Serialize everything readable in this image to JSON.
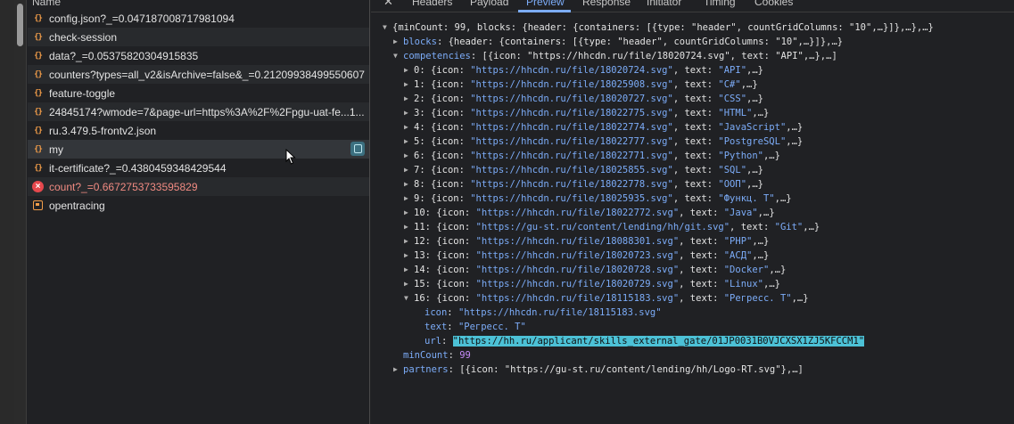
{
  "list": {
    "header": "Name",
    "rows": [
      {
        "name": "config.json?_=0.047187008717981094",
        "type": "json"
      },
      {
        "name": "check-session",
        "type": "json"
      },
      {
        "name": "data?_=0.05375820304915835",
        "type": "json"
      },
      {
        "name": "counters?types=all_v2&isArchive=false&_=0.21209938499550607",
        "type": "json"
      },
      {
        "name": "feature-toggle",
        "type": "json"
      },
      {
        "name": "24845174?wmode=7&page-url=https%3A%2F%2Fpgu-uat-fe...1...",
        "type": "json"
      },
      {
        "name": "ru.3.479.5-frontv2.json",
        "type": "json"
      },
      {
        "name": "my",
        "type": "json"
      },
      {
        "name": "it-certificate?_=0.4380459348429544",
        "type": "json"
      },
      {
        "name": "count?_=0.6672753733595829",
        "type": "error"
      },
      {
        "name": "opentracing",
        "type": "doc"
      }
    ]
  },
  "tabs": [
    "Headers",
    "Payload",
    "Preview",
    "Response",
    "Initiator",
    "Timing",
    "Cookies"
  ],
  "active_tab": "Preview",
  "close_icon": "✕",
  "tree": {
    "root": "{minCount: 99, blocks: {header: {containers: [{type: \"header\", countGridColumns: \"10\",…}]},…},…}",
    "blocks": {
      "key": "blocks",
      "value": "{header: {containers: [{type: \"header\", countGridColumns: \"10\",…}]},…}"
    },
    "competencies": {
      "key": "competencies",
      "value": "[{icon: \"https://hhcdn.ru/file/18020724.svg\", text: \"API\",…},…]"
    },
    "items": [
      {
        "idx": "0",
        "icon": "\"https://hhcdn.ru/file/18020724.svg\"",
        "text": "\"API\""
      },
      {
        "idx": "1",
        "icon": "\"https://hhcdn.ru/file/18025908.svg\"",
        "text": "\"C#\""
      },
      {
        "idx": "2",
        "icon": "\"https://hhcdn.ru/file/18020727.svg\"",
        "text": "\"CSS\""
      },
      {
        "idx": "3",
        "icon": "\"https://hhcdn.ru/file/18022775.svg\"",
        "text": "\"HTML\""
      },
      {
        "idx": "4",
        "icon": "\"https://hhcdn.ru/file/18022774.svg\"",
        "text": "\"JavaScript\""
      },
      {
        "idx": "5",
        "icon": "\"https://hhcdn.ru/file/18022777.svg\"",
        "text": "\"PostgreSQL\""
      },
      {
        "idx": "6",
        "icon": "\"https://hhcdn.ru/file/18022771.svg\"",
        "text": "\"Python\""
      },
      {
        "idx": "7",
        "icon": "\"https://hhcdn.ru/file/18025855.svg\"",
        "text": "\"SQL\""
      },
      {
        "idx": "8",
        "icon": "\"https://hhcdn.ru/file/18022778.svg\"",
        "text": "\"ООП\""
      },
      {
        "idx": "9",
        "icon": "\"https://hhcdn.ru/file/18025935.svg\"",
        "text": "\"Функц. Т\""
      },
      {
        "idx": "10",
        "icon": "\"https://hhcdn.ru/file/18022772.svg\"",
        "text": "\"Java\""
      },
      {
        "idx": "11",
        "icon": "\"https://gu-st.ru/content/lending/hh/git.svg\"",
        "text": "\"Git\""
      },
      {
        "idx": "12",
        "icon": "\"https://hhcdn.ru/file/18088301.svg\"",
        "text": "\"PHP\""
      },
      {
        "idx": "13",
        "icon": "\"https://hhcdn.ru/file/18020723.svg\"",
        "text": "\"АСД\""
      },
      {
        "idx": "14",
        "icon": "\"https://hhcdn.ru/file/18020728.svg\"",
        "text": "\"Docker\""
      },
      {
        "idx": "15",
        "icon": "\"https://hhcdn.ru/file/18020729.svg\"",
        "text": "\"Linux\""
      },
      {
        "idx": "16",
        "icon": "\"https://hhcdn.ru/file/18115183.svg\"",
        "text": "\"Регресс. Т\""
      }
    ],
    "expanded": {
      "icon": "\"https://hhcdn.ru/file/18115183.svg\"",
      "text": "\"Регресс. Т\"",
      "url": "\"https://hh.ru/applicant/skills_external_gate/01JP0031B0VJCXSX1ZJ5KFCCM1\""
    },
    "minCount": {
      "key": "minCount",
      "value": "99"
    },
    "partners": {
      "key": "partners",
      "value": "[{icon: \"https://gu-st.ru/content/lending/hh/Logo-RT.svg\"},…]"
    }
  },
  "colors": {
    "accent": "#7cacf8",
    "highlight": "#4cc1d6",
    "error": "#f28b82"
  }
}
